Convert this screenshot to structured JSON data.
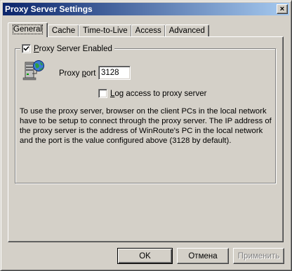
{
  "window": {
    "title": "Proxy Server Settings"
  },
  "titlebar": {
    "close_glyph": "×"
  },
  "tabs": [
    {
      "label": "General",
      "active": true
    },
    {
      "label": "Cache",
      "active": false
    },
    {
      "label": "Time-to-Live",
      "active": false
    },
    {
      "label": "Access",
      "active": false
    },
    {
      "label": "Advanced",
      "active": false
    }
  ],
  "general": {
    "proxy_enabled": {
      "label": "Proxy Server Enabled",
      "checked": true
    },
    "server_icon": "network-server-icon",
    "port": {
      "label": "Proxy port :",
      "value": "3128"
    },
    "log_access": {
      "label": "Log access to proxy server",
      "checked": false
    },
    "description": "To use the proxy server, browser on the client PCs in the local network have to be setup to connect through the proxy server. The IP address of the proxy server is the address of WinRoute's PC in the local network and the port is the value configured above (3128 by default)."
  },
  "buttons": {
    "ok": "OK",
    "cancel": "Отмена",
    "apply": "Применить"
  },
  "colors": {
    "title_start": "#0a246a",
    "title_end": "#a6caf0",
    "face": "#d4d0c8"
  }
}
